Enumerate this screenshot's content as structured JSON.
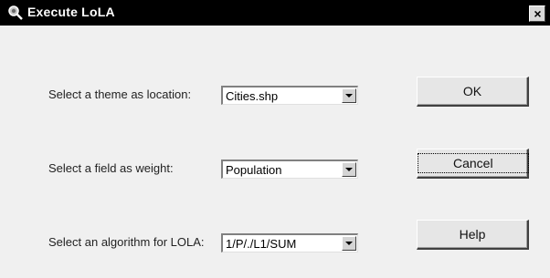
{
  "window": {
    "title": "Execute LoLA",
    "close_label": "×"
  },
  "form": {
    "theme_label": "Select a theme as location:",
    "theme_value": "Cities.shp",
    "weight_label": "Select a field as weight:",
    "weight_value": "Population",
    "algorithm_label": "Select an algorithm for LOLA:",
    "algorithm_value": "1/P/./L1/SUM"
  },
  "buttons": {
    "ok": "OK",
    "cancel": "Cancel",
    "help": "Help"
  },
  "icons": {
    "title": "magnifier-globe-icon",
    "close": "close-icon",
    "dropdown": "chevron-down-icon"
  }
}
